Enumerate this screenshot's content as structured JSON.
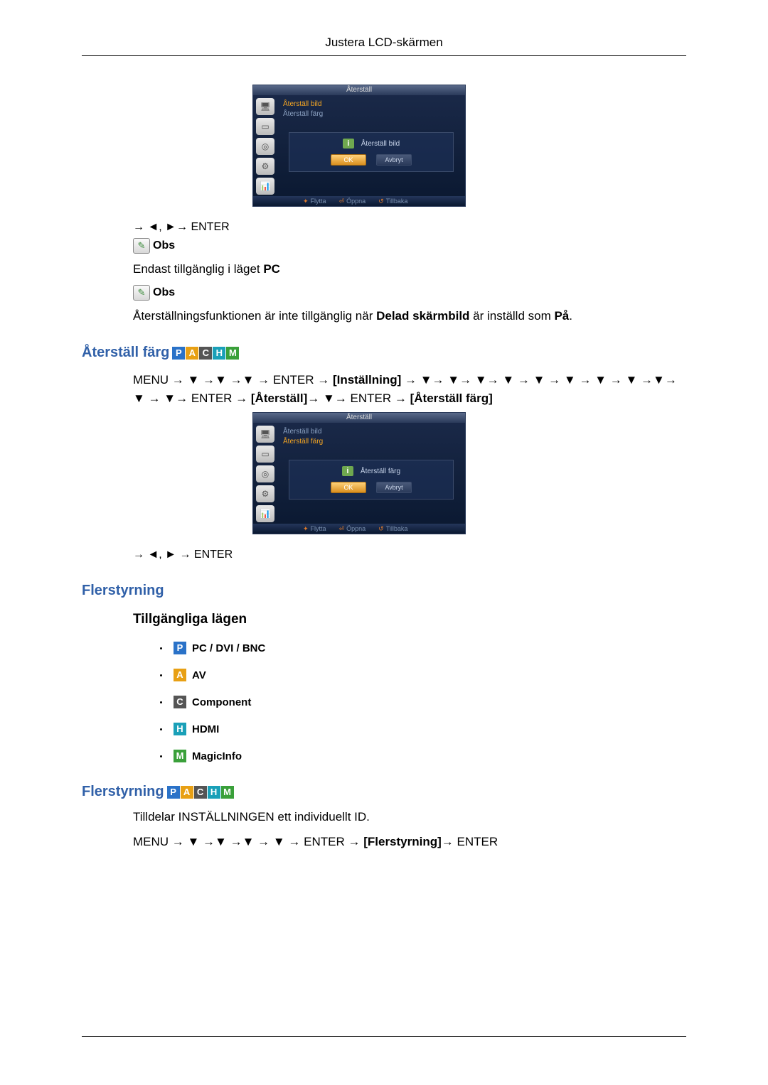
{
  "header": {
    "title": "Justera LCD-skärmen"
  },
  "osd1": {
    "title": "Återställ",
    "items": [
      "Återställ bild",
      "Återställ färg"
    ],
    "dialog_title": "Återställ bild",
    "ok": "OK",
    "cancel": "Avbryt",
    "footer": {
      "move": "Flytta",
      "open": "Öppna",
      "back": "Tillbaka"
    }
  },
  "nav1": "→ ◄, ►→ ENTER",
  "obs_label": "Obs",
  "note1_text": "Endast tillgänglig i läget ",
  "note1_bold": "PC",
  "note2_prefix": "Återställningsfunktionen är inte tillgänglig när ",
  "note2_bold": "Delad skärmbild",
  "note2_mid": " är inställd som ",
  "note2_bold2": "På",
  "note2_suffix": ".",
  "section_reset_color": "Återställ färg",
  "menu_path_color_1": "MENU → ▼ →▼ →▼ → ENTER → ",
  "bracket_installning": "[Inställning]",
  "menu_path_color_2": " → ▼→ ▼→ ▼→ ▼ → ▼ → ▼ → ▼ → ▼ →▼→ ▼ → ▼→ ENTER → ",
  "bracket_aterstall": "[Återställ]",
  "menu_path_color_3": "→ ▼→ ENTER → ",
  "bracket_aterstall_farg": "[Återställ färg]",
  "osd2": {
    "title": "Återställ",
    "items": [
      "Återställ bild",
      "Återställ färg"
    ],
    "dialog_title": "Återställ färg",
    "ok": "OK",
    "cancel": "Avbryt",
    "footer": {
      "move": "Flytta",
      "open": "Öppna",
      "back": "Tillbaka"
    }
  },
  "nav2": "→ ◄, ► → ENTER",
  "section_multi": "Flerstyrning",
  "sub_modes": "Tillgängliga lägen",
  "modes": {
    "p": "PC / DVI / BNC",
    "a": "AV",
    "c": "Component",
    "h": "HDMI",
    "m": "MagicInfo"
  },
  "section_multi2": "Flerstyrning",
  "multi_desc": "Tilldelar INSTÄLLNINGEN ett individuellt ID.",
  "menu_path_multi_1": "MENU → ▼ →▼ →▼ → ▼ → ENTER → ",
  "bracket_flerstyrning": "[Flerstyrning]",
  "menu_path_multi_2": "→ ENTER"
}
